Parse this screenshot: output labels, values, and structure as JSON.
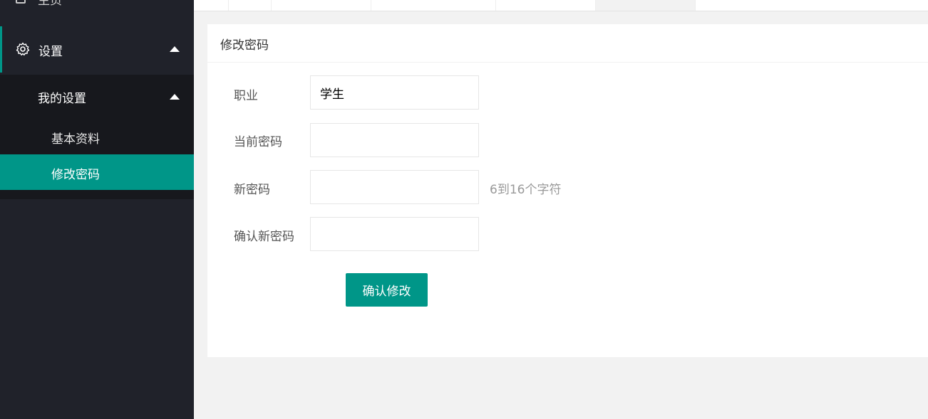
{
  "sidebar": {
    "home_label": "主页",
    "settings_label": "设置",
    "my_settings_label": "我的设置",
    "basic_info_label": "基本资料",
    "change_password_label": "修改密码"
  },
  "card": {
    "title": "修改密码"
  },
  "form": {
    "occupation_label": "职业",
    "occupation_value": "学生",
    "current_password_label": "当前密码",
    "new_password_label": "新密码",
    "new_password_hint": "6到16个字符",
    "confirm_password_label": "确认新密码",
    "submit_label": "确认修改"
  },
  "colors": {
    "accent": "#009688",
    "sidebar_bg": "#20222a",
    "submenu_bg": "#17181d"
  }
}
